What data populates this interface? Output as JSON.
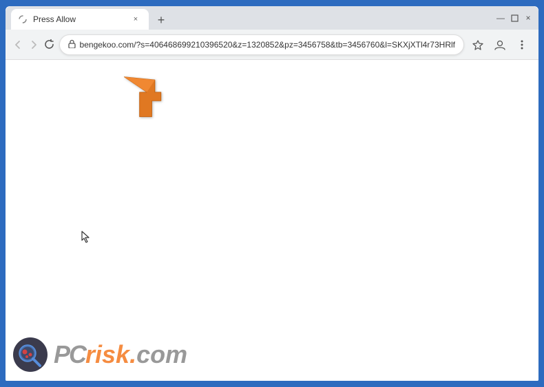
{
  "browser": {
    "title": "Press Allow",
    "url": "bengekoo.com/?s=406468699210396520&z=1320852&pz=3456758&tb=3456760&l=SKXjXTl4r73HRlf",
    "tab_close_label": "×",
    "new_tab_label": "+",
    "window_minimize": "—",
    "window_maximize": "□",
    "window_close": "×"
  },
  "nav": {
    "back_label": "‹",
    "forward_label": "›",
    "reload_label": "✕",
    "bookmark_label": "☆",
    "profile_label": "👤",
    "menu_label": "⋮"
  },
  "watermark": {
    "pc_text": "PC",
    "risk_text": "risk",
    "dot_text": ".",
    "com_text": "com"
  }
}
